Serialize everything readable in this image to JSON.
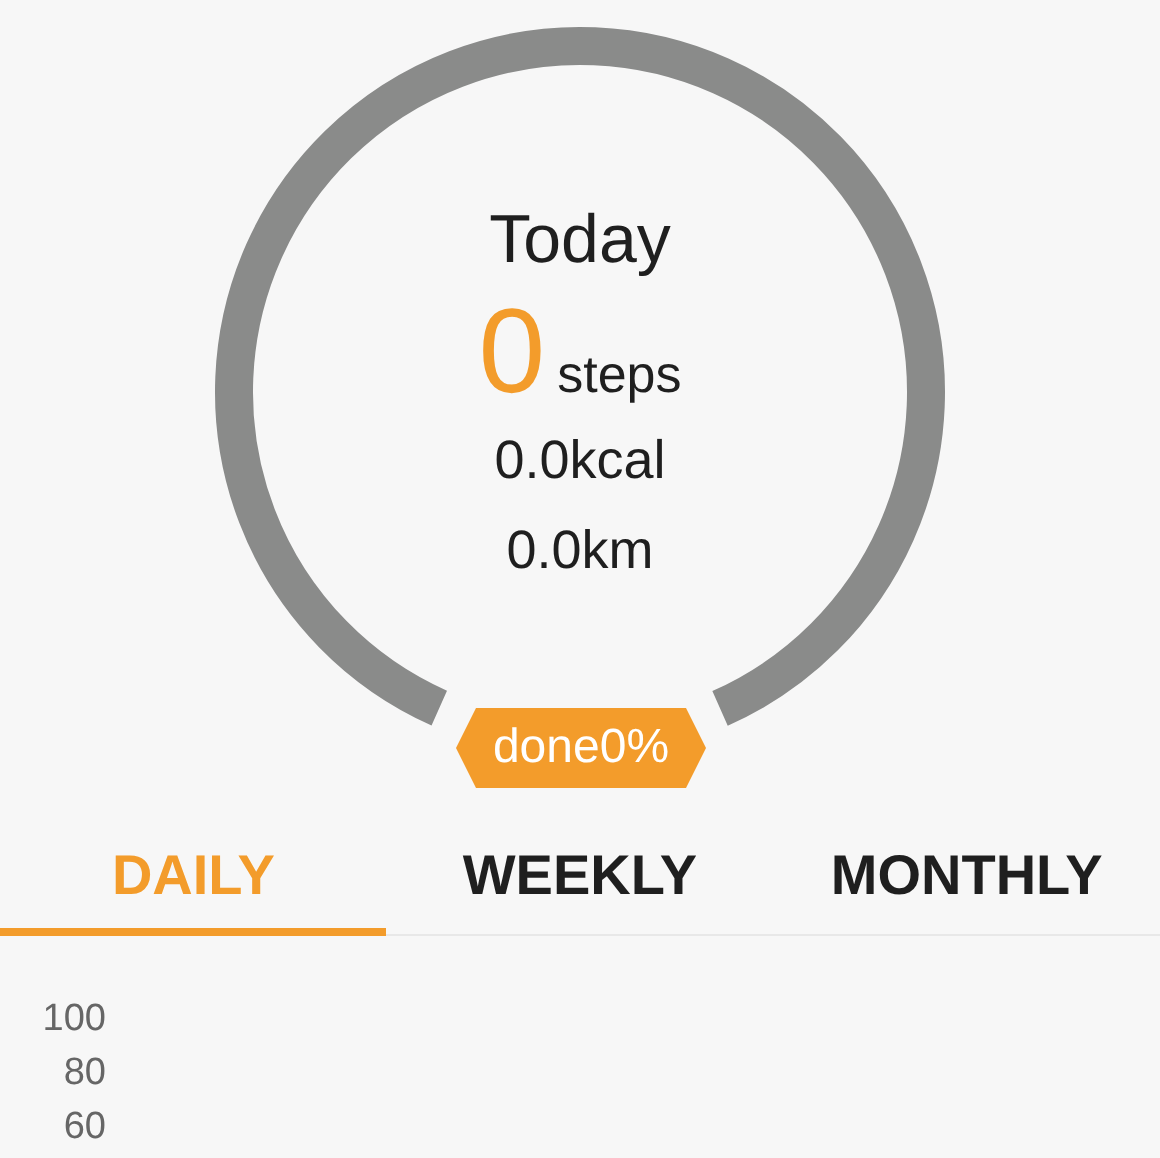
{
  "summary": {
    "title": "Today",
    "steps_value": "0",
    "steps_unit": "steps",
    "calories": "0.0kcal",
    "distance": "0.0km"
  },
  "progress": {
    "badge": "done0%"
  },
  "tabs": [
    {
      "label": "DAILY",
      "selected": true
    },
    {
      "label": "WEEKLY",
      "selected": false
    },
    {
      "label": "MONTHLY",
      "selected": false
    }
  ],
  "y_axis_labels": [
    "100",
    "80",
    "60"
  ]
}
